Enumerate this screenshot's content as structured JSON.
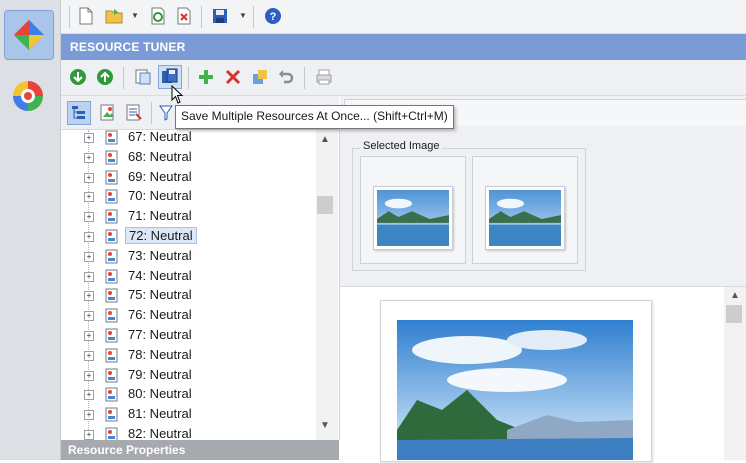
{
  "app": {
    "header_title": "RESOURCE TUNER",
    "left_bar": {
      "items": [
        {
          "icon": "resource-tuner-logo-icon",
          "active": true
        },
        {
          "icon": "color-wheel-icon",
          "active": false
        }
      ]
    }
  },
  "top_toolbar": {
    "buttons": [
      {
        "icon": "new-document-icon"
      },
      {
        "icon": "open-folder-icon"
      },
      {
        "icon": "dropdown-arrow-icon"
      },
      {
        "icon": "refresh-icon"
      },
      {
        "icon": "close-file-icon"
      },
      {
        "icon": "save-disk-icon"
      },
      {
        "icon": "dropdown-arrow-icon"
      },
      {
        "icon": "help-icon"
      }
    ]
  },
  "second_toolbar": {
    "buttons": [
      {
        "icon": "down-arrow-green-icon"
      },
      {
        "icon": "up-arrow-green-icon"
      },
      {
        "icon": "save-resource-icon"
      },
      {
        "icon": "save-multiple-resources-icon",
        "hovered": true
      },
      {
        "icon": "add-icon"
      },
      {
        "icon": "delete-icon"
      },
      {
        "icon": "edit-resource-icon"
      },
      {
        "icon": "undo-icon"
      },
      {
        "icon": "print-icon"
      }
    ]
  },
  "tooltip": {
    "text": "Save Multiple Resources At Once... (Shift+Ctrl+M)"
  },
  "tree_toolbar": {
    "buttons": [
      {
        "icon": "tree-view-icon",
        "active": true
      },
      {
        "icon": "image-view-icon"
      },
      {
        "icon": "text-view-icon"
      },
      {
        "icon": "filter-icon"
      }
    ]
  },
  "tree": {
    "items": [
      {
        "label": "67: Neutral",
        "selected": false
      },
      {
        "label": "68: Neutral",
        "selected": false
      },
      {
        "label": "69: Neutral",
        "selected": false
      },
      {
        "label": "70: Neutral",
        "selected": false
      },
      {
        "label": "71: Neutral",
        "selected": false
      },
      {
        "label": "72: Neutral",
        "selected": true
      },
      {
        "label": "73: Neutral",
        "selected": false
      },
      {
        "label": "74: Neutral",
        "selected": false
      },
      {
        "label": "75: Neutral",
        "selected": false
      },
      {
        "label": "76: Neutral",
        "selected": false
      },
      {
        "label": "77: Neutral",
        "selected": false
      },
      {
        "label": "78: Neutral",
        "selected": false
      },
      {
        "label": "79: Neutral",
        "selected": false
      },
      {
        "label": "80: Neutral",
        "selected": false
      },
      {
        "label": "81: Neutral",
        "selected": false
      },
      {
        "label": "82: Neutral",
        "selected": false
      }
    ]
  },
  "resource_properties": {
    "label": "Resource Properties"
  },
  "preview": {
    "selected_image_label": "Selected Image",
    "thumbnails": [
      {
        "icon": "landscape-thumbnail"
      },
      {
        "icon": "landscape-thumbnail"
      }
    ]
  },
  "colors": {
    "header_bg": "#7b9bd6",
    "selection_bg": "#dce8f8",
    "properties_bar_bg": "#a6a9ae"
  }
}
